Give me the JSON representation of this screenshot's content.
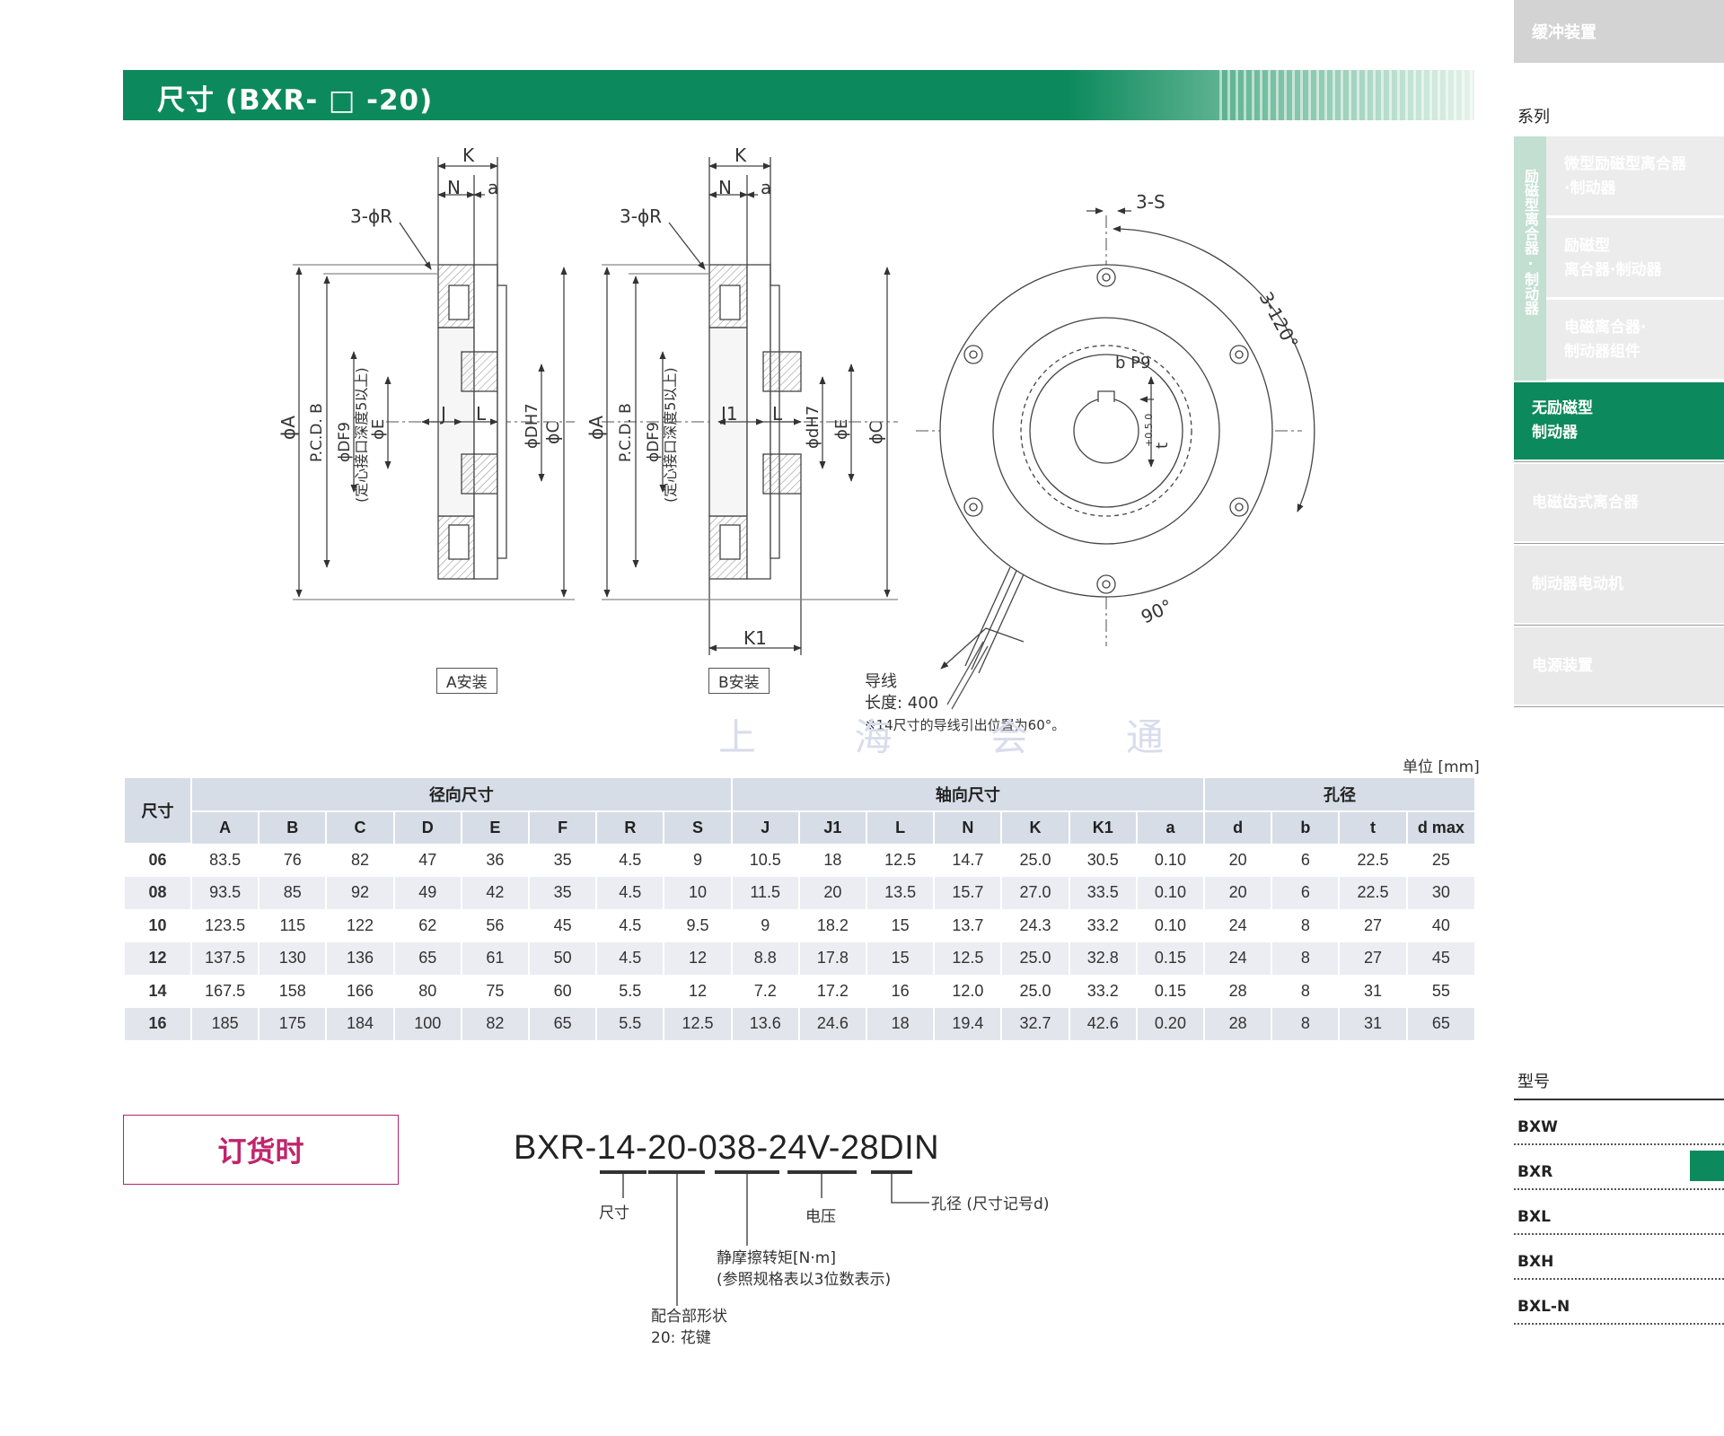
{
  "header": {
    "title": "尺寸 (BXR- □ -20)"
  },
  "sidebar": {
    "top_label": "缓冲装置",
    "series_label": "系列",
    "group_label": "励磁型离合器·制动器",
    "group_items": [
      {
        "line1": "微型励磁型离合器",
        "line2": "·制动器"
      },
      {
        "line1": "励磁型",
        "line2": "离合器·制动器"
      },
      {
        "line1": "电磁离合器·",
        "line2": "制动器组件"
      }
    ],
    "items": [
      {
        "line1": "无励磁型",
        "line2": "制动器",
        "active": true
      },
      {
        "line1": "电磁齿式离合器",
        "line2": ""
      },
      {
        "line1": "制动器电动机",
        "line2": ""
      },
      {
        "line1": "电源装置",
        "line2": ""
      }
    ],
    "model_label": "型号",
    "models": [
      {
        "name": "BXW",
        "active": false
      },
      {
        "name": "BXR",
        "active": true
      },
      {
        "name": "BXL",
        "active": false
      },
      {
        "name": "BXH",
        "active": false
      },
      {
        "name": "BXL-N",
        "active": false
      }
    ],
    "accent_color": "#0d8a5d"
  },
  "drawings": {
    "mount_a_label": "A安装",
    "mount_b_label": "B安装",
    "view_a": {
      "K": "K",
      "N": "N",
      "a": "a",
      "R": "3-ϕR",
      "A": "ϕA",
      "B": "P.C.D. B",
      "DF9": "ϕDF9",
      "note": "(定心接口深度5以上)",
      "E": "ϕE",
      "J": "J",
      "L": "L",
      "DH7": "ϕDH7",
      "C": "ϕC"
    },
    "view_b": {
      "K": "K",
      "N": "N",
      "a": "a",
      "R": "3-ϕR",
      "A": "ϕA",
      "B": "P.C.D. B",
      "DF9": "ϕDF9",
      "note": "(定心接口深度5以上)",
      "J1": "J1",
      "L": "L",
      "dH7": "ϕdH7",
      "E": "ϕE",
      "C": "ϕC",
      "K1": "K1"
    },
    "front": {
      "S": "3-S",
      "angle120": "3-120°",
      "bP9": "b P9",
      "t": "t",
      "tol": "+0.5 0",
      "angle90": "90°"
    },
    "wire_label": "导线",
    "wire_length": "长度: 400",
    "wire_note": "※14尺寸的导线引出位置为60°。",
    "watermark": "上 海 会 通"
  },
  "table": {
    "unit": "单位 [mm]",
    "size_header": "尺寸",
    "group_headers": [
      "径向尺寸",
      "轴向尺寸",
      "孔径"
    ],
    "columns": [
      "A",
      "B",
      "C",
      "D",
      "E",
      "F",
      "R",
      "S",
      "J",
      "J1",
      "L",
      "N",
      "K",
      "K1",
      "a",
      "d",
      "b",
      "t",
      "d max"
    ],
    "rows": [
      [
        "06",
        "83.5",
        "76",
        "82",
        "47",
        "36",
        "35",
        "4.5",
        "9",
        "10.5",
        "18",
        "12.5",
        "14.7",
        "25.0",
        "30.5",
        "0.10",
        "20",
        "6",
        "22.5",
        "25"
      ],
      [
        "08",
        "93.5",
        "85",
        "92",
        "49",
        "42",
        "35",
        "4.5",
        "10",
        "11.5",
        "20",
        "13.5",
        "15.7",
        "27.0",
        "33.5",
        "0.10",
        "20",
        "6",
        "22.5",
        "30"
      ],
      [
        "10",
        "123.5",
        "115",
        "122",
        "62",
        "56",
        "45",
        "4.5",
        "9.5",
        "9",
        "18.2",
        "15",
        "13.7",
        "24.3",
        "33.2",
        "0.10",
        "24",
        "8",
        "27",
        "40"
      ],
      [
        "12",
        "137.5",
        "130",
        "136",
        "65",
        "61",
        "50",
        "4.5",
        "12",
        "8.8",
        "17.8",
        "15",
        "12.5",
        "25.0",
        "32.8",
        "0.15",
        "24",
        "8",
        "27",
        "45"
      ],
      [
        "14",
        "167.5",
        "158",
        "166",
        "80",
        "75",
        "60",
        "5.5",
        "12",
        "7.2",
        "17.2",
        "16",
        "12.0",
        "25.0",
        "33.2",
        "0.15",
        "28",
        "8",
        "31",
        "55"
      ],
      [
        "16",
        "185",
        "175",
        "184",
        "100",
        "82",
        "65",
        "5.5",
        "12.5",
        "13.6",
        "24.6",
        "18",
        "19.4",
        "32.7",
        "42.6",
        "0.20",
        "28",
        "8",
        "31",
        "65"
      ]
    ]
  },
  "order": {
    "box_label": "订货时",
    "code": "BXR-14-20-038-24V-28DIN",
    "ann_size": "尺寸",
    "ann_voltage": "电压",
    "ann_bore": "孔径 (尺寸记号d)",
    "ann_torque_1": "静摩擦转矩[N·m]",
    "ann_torque_2": "(参照规格表以3位数表示)",
    "ann_shape_1": "配合部形状",
    "ann_shape_2": "20: 花键"
  }
}
